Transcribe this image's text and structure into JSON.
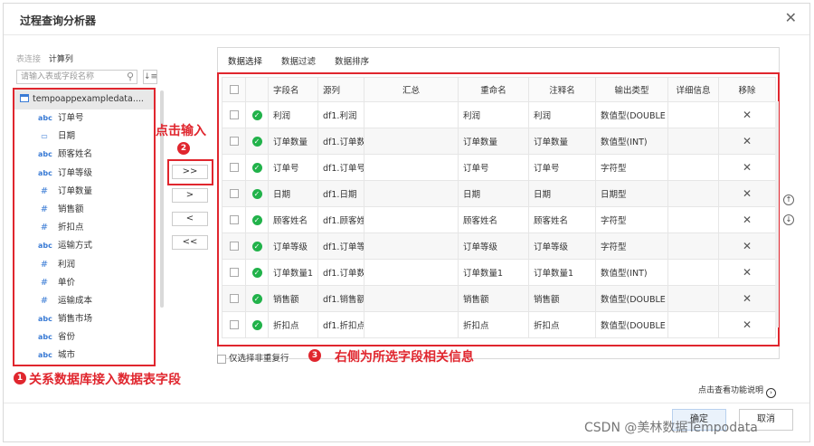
{
  "dialog": {
    "title": "过程查询分析器",
    "close_icon": "close-icon"
  },
  "left": {
    "tabs": [
      "表连接",
      "计算列"
    ],
    "search_placeholder": "请输入表或字段名称",
    "root": "tempoappexampledata....",
    "fields": [
      {
        "type": "abc",
        "name": "订单号"
      },
      {
        "type": "date",
        "name": "日期"
      },
      {
        "type": "abc",
        "name": "顾客姓名"
      },
      {
        "type": "abc",
        "name": "订单等级"
      },
      {
        "type": "#",
        "name": "订单数量"
      },
      {
        "type": "#",
        "name": "销售额"
      },
      {
        "type": "#",
        "name": "折扣点"
      },
      {
        "type": "abc",
        "name": "运输方式"
      },
      {
        "type": "#",
        "name": "利润"
      },
      {
        "type": "#",
        "name": "单价"
      },
      {
        "type": "#",
        "name": "运输成本"
      },
      {
        "type": "abc",
        "name": "销售市场"
      },
      {
        "type": "abc",
        "name": "省份"
      },
      {
        "type": "abc",
        "name": "城市"
      }
    ]
  },
  "move_buttons": {
    "add_all": ">>",
    "add": ">",
    "remove": "<",
    "remove_all": "<<"
  },
  "right": {
    "tabs": [
      "数据选择",
      "数据过滤",
      "数据排序"
    ],
    "columns": [
      "字段名",
      "源列",
      "汇总",
      "重命名",
      "注释名",
      "输出类型",
      "详细信息",
      "移除"
    ],
    "rows": [
      [
        "利润",
        "df1.利润",
        "",
        "利润",
        "利润",
        "数值型(DOUBLE"
      ],
      [
        "订单数量",
        "df1.订单数",
        "",
        "订单数量",
        "订单数量",
        "数值型(INT)"
      ],
      [
        "订单号",
        "df1.订单号",
        "",
        "订单号",
        "订单号",
        "字符型"
      ],
      [
        "日期",
        "df1.日期",
        "",
        "日期",
        "日期",
        "日期型"
      ],
      [
        "顾客姓名",
        "df1.顾客姓",
        "",
        "顾客姓名",
        "顾客姓名",
        "字符型"
      ],
      [
        "订单等级",
        "df1.订单等",
        "",
        "订单等级",
        "订单等级",
        "字符型"
      ],
      [
        "订单数量1",
        "df1.订单数",
        "",
        "订单数量1",
        "订单数量1",
        "数值型(INT)"
      ],
      [
        "销售额",
        "df1.销售额",
        "",
        "销售额",
        "销售额",
        "数值型(DOUBLE"
      ],
      [
        "折扣点",
        "df1.折扣点",
        "",
        "折扣点",
        "折扣点",
        "数值型(DOUBLE"
      ]
    ],
    "remove_glyph": "✕",
    "dedup_label": "仅选择非重复行"
  },
  "annotations": {
    "a1": "关系数据库接入数据表字段",
    "a2": "点击输入",
    "a3": "右侧为所选字段相关信息",
    "n1": "1",
    "n2": "2",
    "n3": "3"
  },
  "footer": {
    "help": "点击查看功能说明",
    "ok": "确定",
    "cancel": "取消",
    "watermark": "CSDN @美林数据Tempodata"
  },
  "colors": {
    "annotation": "#e0262e",
    "ok_status": "#21b24a",
    "field_icon": "#3a7bd5"
  }
}
